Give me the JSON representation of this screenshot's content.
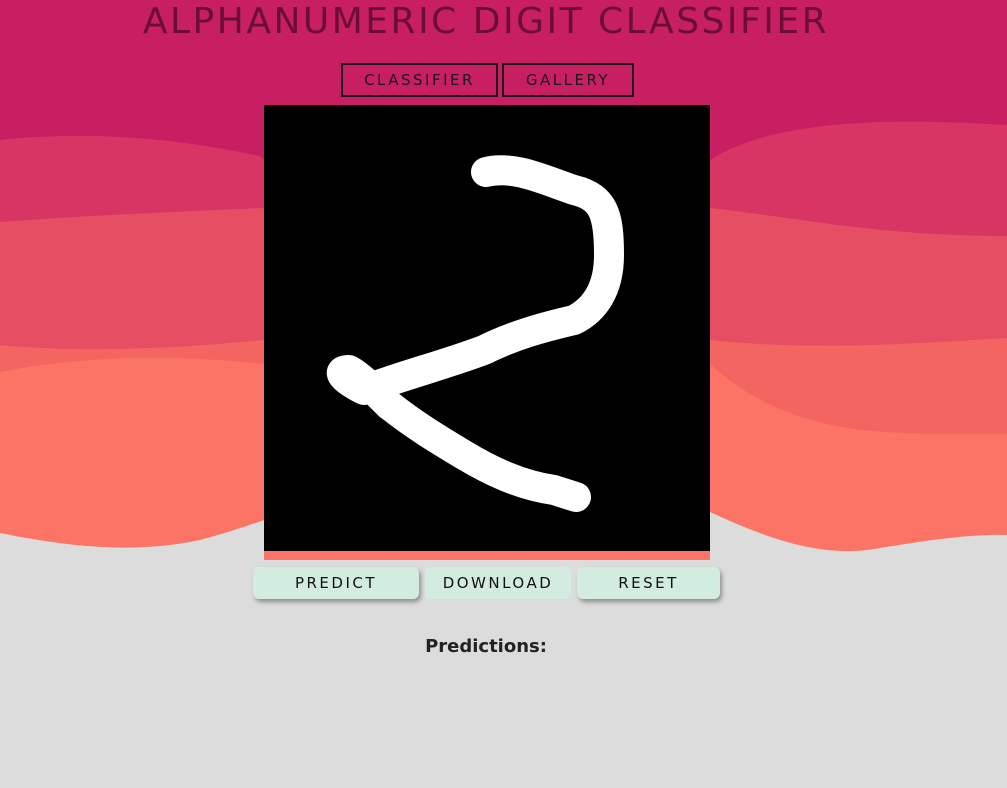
{
  "app": {
    "title": "ALPHANUMERIC DIGIT CLASSIFIER"
  },
  "nav": {
    "items": [
      {
        "label": "CLASSIFIER"
      },
      {
        "label": "GALLERY"
      }
    ]
  },
  "canvas": {
    "background": "#000000",
    "stroke_color": "#ffffff",
    "drawn_character": "2"
  },
  "actions": {
    "predict_label": "PREDICT",
    "download_label": "DOWNLOAD",
    "reset_label": "RESET"
  },
  "predictions": {
    "label": "Predictions:"
  },
  "colors": {
    "band_top": "#c81f63",
    "band_2": "#d83564",
    "band_3": "#e64f63",
    "band_4": "#f26560",
    "band_5": "#fb7465",
    "page_bg": "#dcdcdc",
    "button_bg": "#d3ece0"
  }
}
